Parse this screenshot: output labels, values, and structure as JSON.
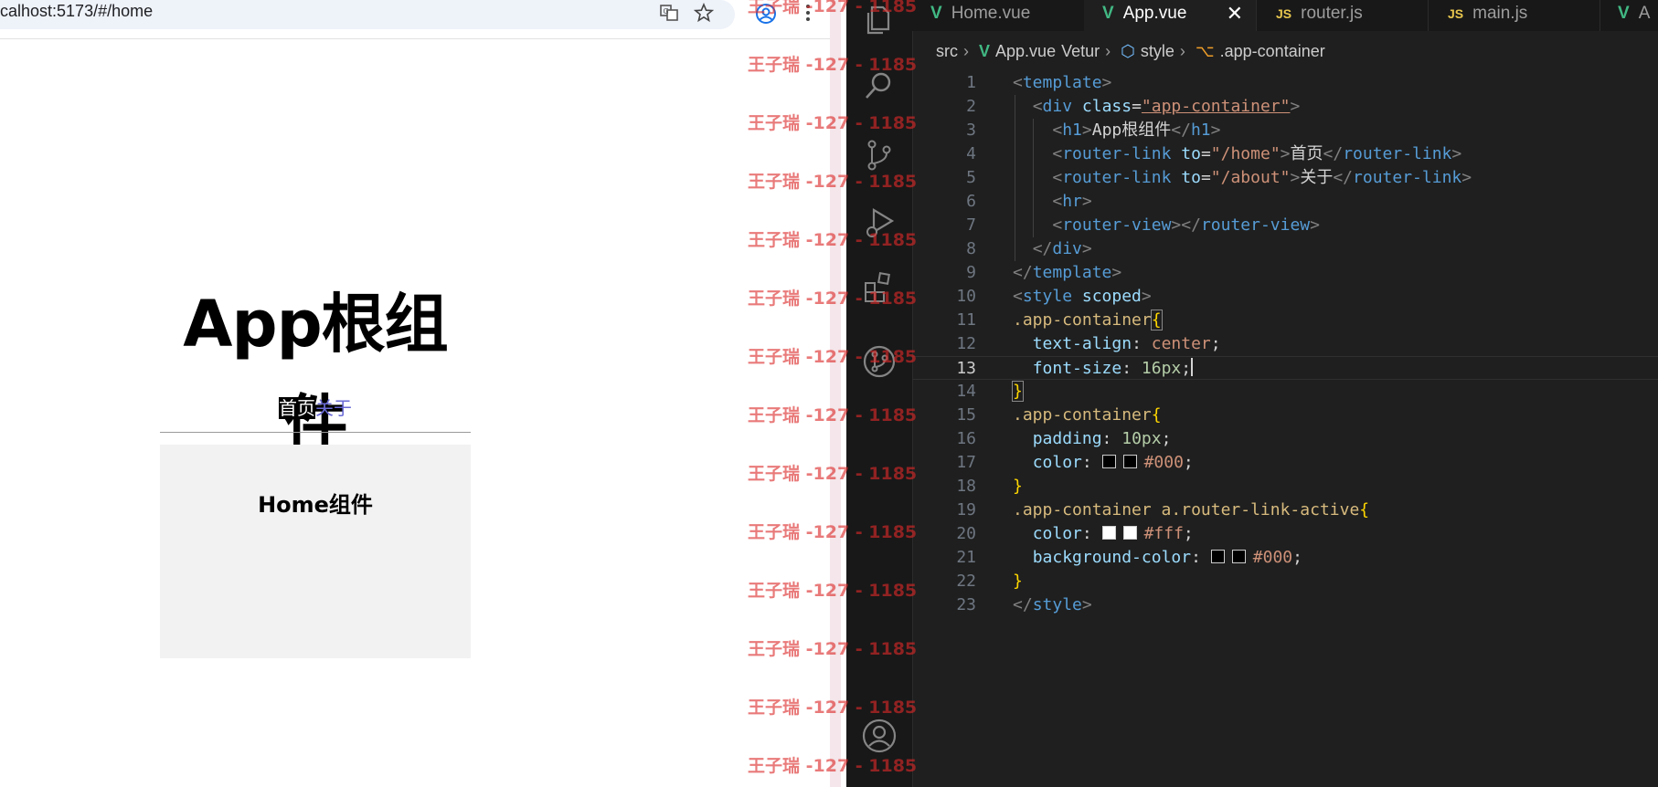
{
  "browser": {
    "url": "calhost:5173/#/home",
    "icons": [
      "translate-icon",
      "star-icon",
      "profile-icon",
      "more-icon"
    ]
  },
  "page": {
    "h1": "App根组件",
    "nav_home": "首页",
    "nav_about": "关于",
    "home_title": "Home组件"
  },
  "watermark": {
    "text": "王子瑞 -127 - 1185"
  },
  "vscode": {
    "tabs": [
      {
        "label": "Home.vue",
        "type": "vue"
      },
      {
        "label": "App.vue",
        "type": "vue",
        "active": true
      },
      {
        "label": "router.js",
        "type": "js"
      },
      {
        "label": "main.js",
        "type": "js"
      },
      {
        "label": "A",
        "type": "vue"
      }
    ],
    "js_badge": "JS",
    "close_glyph": "✕",
    "breadcrumb": [
      "src",
      "App.vue",
      "Vetur",
      "style",
      ".app-container"
    ],
    "line_numbers": [
      "1",
      "2",
      "3",
      "4",
      "5",
      "6",
      "7",
      "8",
      "9",
      "10",
      "11",
      "12",
      "13",
      "14",
      "15",
      "16",
      "17",
      "18",
      "19",
      "20",
      "21",
      "22",
      "23"
    ],
    "current_line": "13",
    "code": {
      "template_tag": "template",
      "div_tag": "div",
      "class_attr": "class",
      "class_val": "\"app-container\"",
      "h1_tag": "h1",
      "h1_text": "App根组件",
      "router_link": "router-link",
      "to_attr": "to",
      "home_path": "\"/home\"",
      "home_text": "首页",
      "about_path": "\"/about\"",
      "about_text": "关于",
      "hr_tag": "hr",
      "router_view": "router-view",
      "style_tag": "style",
      "scoped_attr": "scoped",
      "selector1": ".app-container",
      "text_align": "text-align",
      "center": "center",
      "font_size": "font-size",
      "px16": "16px",
      "padding": "padding",
      "px10": "10px",
      "color": "color",
      "c000": "#000",
      "selector3": ".app-container a.router-link-active",
      "cfff": "#fff",
      "background_color": "background-color"
    }
  },
  "colors": {
    "vue_green": "#41b883",
    "js_yellow": "#e8c64e",
    "active_link_bg": "#000000",
    "link_color": "#6a6ad6"
  }
}
